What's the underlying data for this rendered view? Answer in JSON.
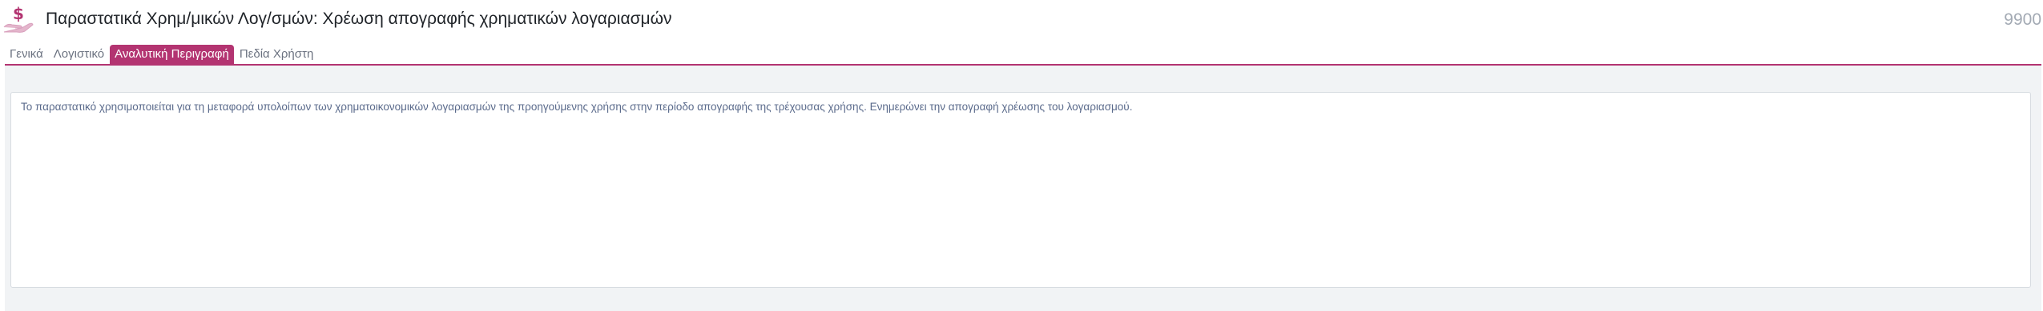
{
  "header": {
    "icon": "hand-with-dollar-icon",
    "title": "Παραστατικά Χρημ/μικών Λογ/σμών: Χρέωση απογραφής χρηματικών λογαριασμών",
    "code": "9900"
  },
  "tabs": [
    {
      "label": "Γενικά",
      "active": false
    },
    {
      "label": "Λογιστικό",
      "active": false
    },
    {
      "label": "Αναλυτική Περιγραφή",
      "active": true
    },
    {
      "label": "Πεδία Χρήστη",
      "active": false
    }
  ],
  "description": {
    "text": "Το παραστατικό χρησιμοποιείται για τη μεταφορά υπολοίπων των χρηματοικονομικών λογαριασμών της προηγούμενης χρήσης στην περίοδο απογραφής της τρέχουσας χρήσης. Ενημερώνει την απογραφή χρέωσης του λογαριασμού."
  },
  "colors": {
    "accent": "#b33471",
    "icon": "#d9a0bd",
    "panel_bg": "#f1f3f5"
  }
}
